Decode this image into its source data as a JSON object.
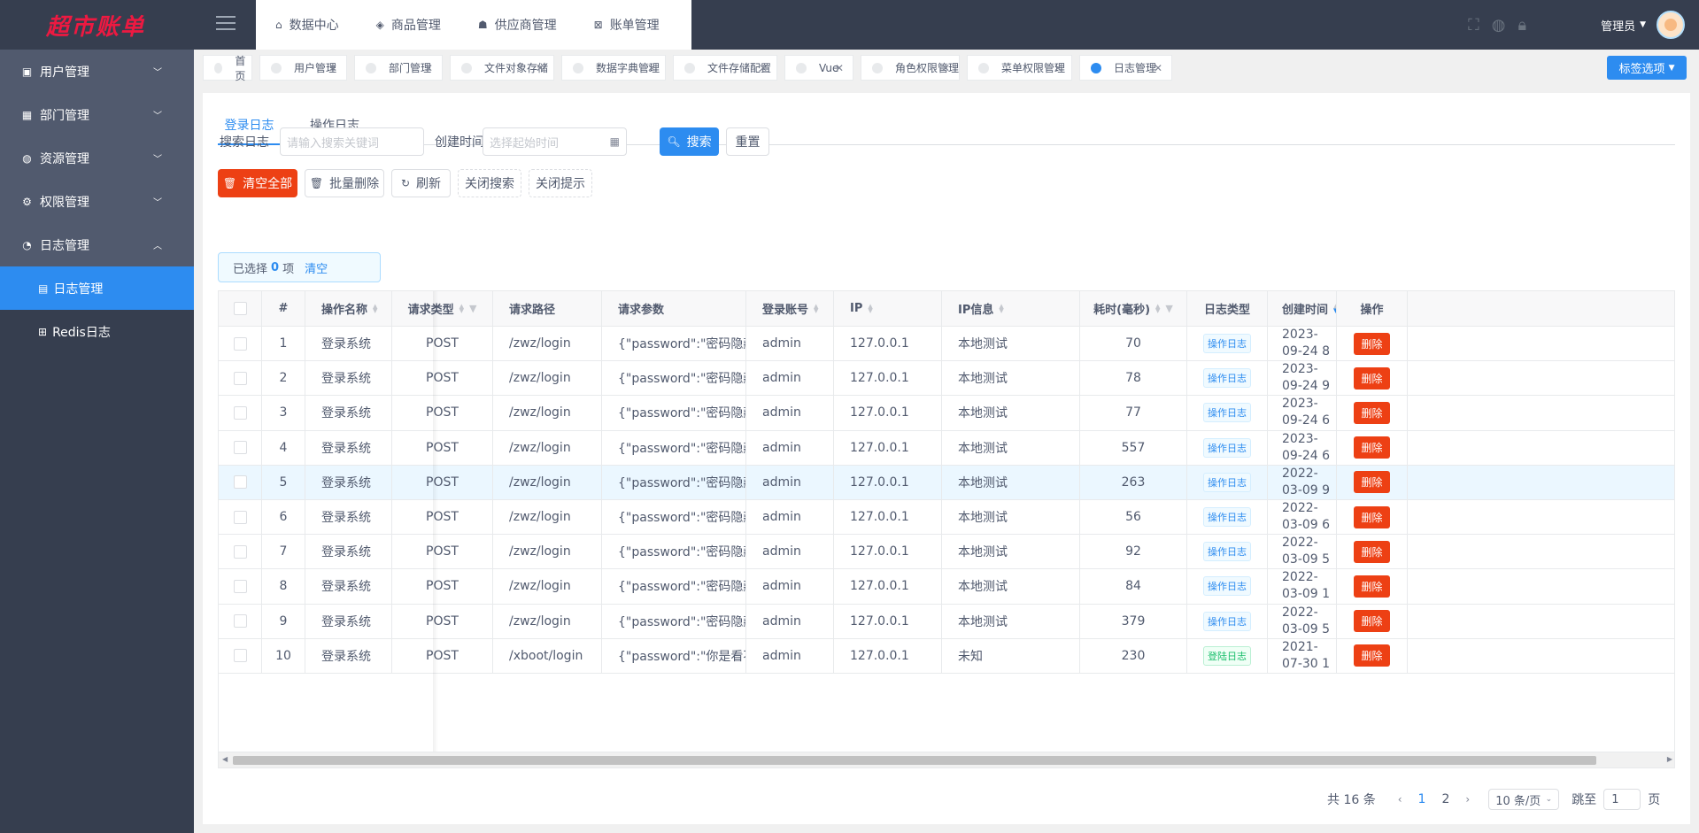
{
  "logo": "超市账单",
  "sidebar": {
    "groups": [
      {
        "label": "用户管理",
        "icon": "user-card-icon"
      },
      {
        "label": "部门管理",
        "icon": "grid-icon"
      },
      {
        "label": "资源管理",
        "icon": "globe-icon"
      },
      {
        "label": "权限管理",
        "icon": "gear-icon"
      },
      {
        "label": "日志管理",
        "icon": "pie-icon"
      }
    ],
    "sub_items": [
      {
        "label": "日志管理",
        "icon": "document-icon",
        "active": true
      },
      {
        "label": "Redis日志",
        "icon": "bed-icon",
        "active": false
      }
    ]
  },
  "topnav": {
    "items": [
      {
        "label": "数据中心",
        "icon": "home-icon"
      },
      {
        "label": "商品管理",
        "icon": "tag-icon"
      },
      {
        "label": "供应商管理",
        "icon": "truck-icon"
      },
      {
        "label": "账单管理",
        "icon": "bill-icon"
      }
    ],
    "user": "管理员"
  },
  "tags": [
    {
      "label": "首页",
      "closable": false
    },
    {
      "label": "用户管理",
      "closable": true
    },
    {
      "label": "部门管理",
      "closable": true
    },
    {
      "label": "文件对象存储",
      "closable": true
    },
    {
      "label": "数据字典管理",
      "closable": true
    },
    {
      "label": "文件存储配置",
      "closable": true
    },
    {
      "label": "Vue",
      "closable": true
    },
    {
      "label": "角色权限管理",
      "closable": true
    },
    {
      "label": "菜单权限管理",
      "closable": true
    },
    {
      "label": "日志管理",
      "closable": true,
      "active": true
    }
  ],
  "tag_options": "标签选项",
  "tabs": [
    "登录日志",
    "操作日志"
  ],
  "search": {
    "label": "搜索日志",
    "placeholder": "请输入搜索关键词",
    "time_label": "创建时间",
    "time_placeholder": "选择起始时间",
    "search_btn": "搜索",
    "reset_btn": "重置"
  },
  "toolbar": {
    "clear_all": "清空全部",
    "batch_delete": "批量删除",
    "refresh": "刷新",
    "close_search": "关闭搜索",
    "close_tip": "关闭提示"
  },
  "alert": {
    "prefix": "已选择",
    "count": "0",
    "suffix": "项",
    "clear": "清空"
  },
  "table": {
    "headers": [
      "#",
      "操作名称",
      "请求类型",
      "请求路径",
      "请求参数",
      "登录账号",
      "IP",
      "IP信息",
      "耗时(毫秒)",
      "日志类型",
      "创建时间",
      "操作"
    ],
    "rows": [
      {
        "no": "1",
        "name": "登录系统",
        "method": "POST",
        "path": "/zwz/login",
        "params": "{\"password\":\"密码隐藏...",
        "account": "admin",
        "ip": "127.0.0.1",
        "ipinfo": "本地测试",
        "cost": "70",
        "type": "操作日志",
        "type_color": "blue",
        "time": "2023-09-24 8",
        "action": "删除"
      },
      {
        "no": "2",
        "name": "登录系统",
        "method": "POST",
        "path": "/zwz/login",
        "params": "{\"password\":\"密码隐藏...",
        "account": "admin",
        "ip": "127.0.0.1",
        "ipinfo": "本地测试",
        "cost": "78",
        "type": "操作日志",
        "type_color": "blue",
        "time": "2023-09-24 9",
        "action": "删除"
      },
      {
        "no": "3",
        "name": "登录系统",
        "method": "POST",
        "path": "/zwz/login",
        "params": "{\"password\":\"密码隐藏...",
        "account": "admin",
        "ip": "127.0.0.1",
        "ipinfo": "本地测试",
        "cost": "77",
        "type": "操作日志",
        "type_color": "blue",
        "time": "2023-09-24 6",
        "action": "删除"
      },
      {
        "no": "4",
        "name": "登录系统",
        "method": "POST",
        "path": "/zwz/login",
        "params": "{\"password\":\"密码隐藏...",
        "account": "admin",
        "ip": "127.0.0.1",
        "ipinfo": "本地测试",
        "cost": "557",
        "type": "操作日志",
        "type_color": "blue",
        "time": "2023-09-24 6",
        "action": "删除"
      },
      {
        "no": "5",
        "name": "登录系统",
        "method": "POST",
        "path": "/zwz/login",
        "params": "{\"password\":\"密码隐藏...",
        "account": "admin",
        "ip": "127.0.0.1",
        "ipinfo": "本地测试",
        "cost": "263",
        "type": "操作日志",
        "type_color": "blue",
        "time": "2022-03-09 9",
        "action": "删除"
      },
      {
        "no": "6",
        "name": "登录系统",
        "method": "POST",
        "path": "/zwz/login",
        "params": "{\"password\":\"密码隐藏...",
        "account": "admin",
        "ip": "127.0.0.1",
        "ipinfo": "本地测试",
        "cost": "56",
        "type": "操作日志",
        "type_color": "blue",
        "time": "2022-03-09 6",
        "action": "删除"
      },
      {
        "no": "7",
        "name": "登录系统",
        "method": "POST",
        "path": "/zwz/login",
        "params": "{\"password\":\"密码隐藏...",
        "account": "admin",
        "ip": "127.0.0.1",
        "ipinfo": "本地测试",
        "cost": "92",
        "type": "操作日志",
        "type_color": "blue",
        "time": "2022-03-09 5",
        "action": "删除"
      },
      {
        "no": "8",
        "name": "登录系统",
        "method": "POST",
        "path": "/zwz/login",
        "params": "{\"password\":\"密码隐藏...",
        "account": "admin",
        "ip": "127.0.0.1",
        "ipinfo": "本地测试",
        "cost": "84",
        "type": "操作日志",
        "type_color": "blue",
        "time": "2022-03-09 1",
        "action": "删除"
      },
      {
        "no": "9",
        "name": "登录系统",
        "method": "POST",
        "path": "/zwz/login",
        "params": "{\"password\":\"密码隐藏...",
        "account": "admin",
        "ip": "127.0.0.1",
        "ipinfo": "本地测试",
        "cost": "379",
        "type": "操作日志",
        "type_color": "blue",
        "time": "2022-03-09 5",
        "action": "删除"
      },
      {
        "no": "10",
        "name": "登录系统",
        "method": "POST",
        "path": "/xboot/login",
        "params": "{\"password\":\"你是看不...",
        "account": "admin",
        "ip": "127.0.0.1",
        "ipinfo": "未知",
        "cost": "230",
        "type": "登陆日志",
        "type_color": "green",
        "time": "2021-07-30 1",
        "action": "删除"
      }
    ]
  },
  "pager": {
    "total": "共 16 条",
    "pages": [
      "1",
      "2"
    ],
    "current": "1",
    "page_size": "10 条/页",
    "jump_label": "跳至",
    "jump_value": "1",
    "page_suffix": "页"
  }
}
